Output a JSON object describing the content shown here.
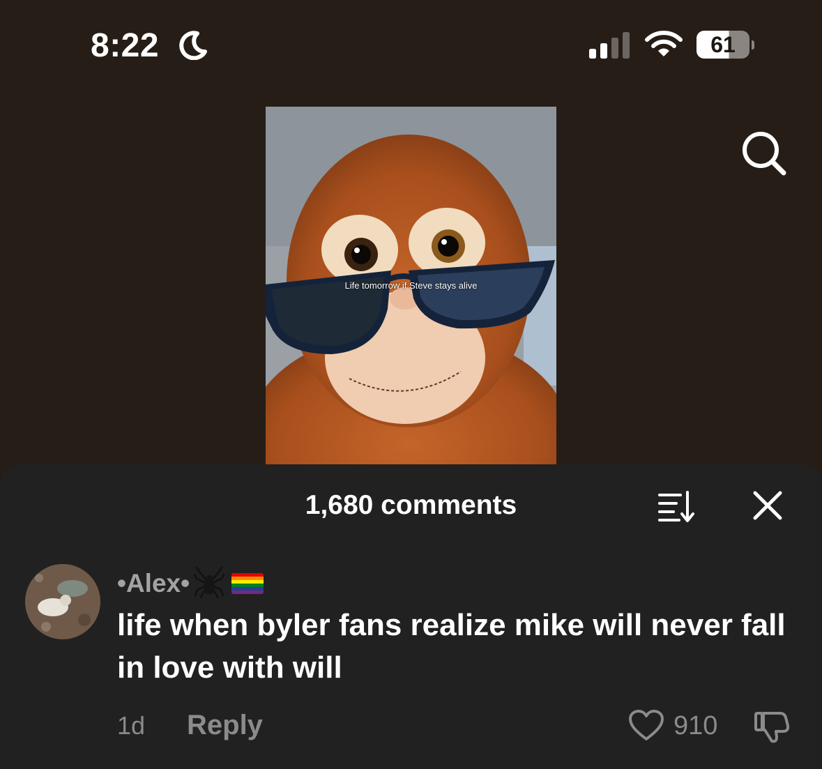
{
  "status_bar": {
    "time": "8:22",
    "battery": "61"
  },
  "video": {
    "caption": "Life tomorrow if Steve stays alive"
  },
  "comments_sheet": {
    "title": "1,680 comments",
    "comment": {
      "username": "•Alex•",
      "text": "life when byler fans realize mike will never fall in love with will",
      "time_ago": "1d",
      "reply_label": "Reply",
      "like_count": "910"
    }
  },
  "colors": {
    "background": "#261d16",
    "sheet": "#212121",
    "muted_text": "#8b8b8b"
  }
}
